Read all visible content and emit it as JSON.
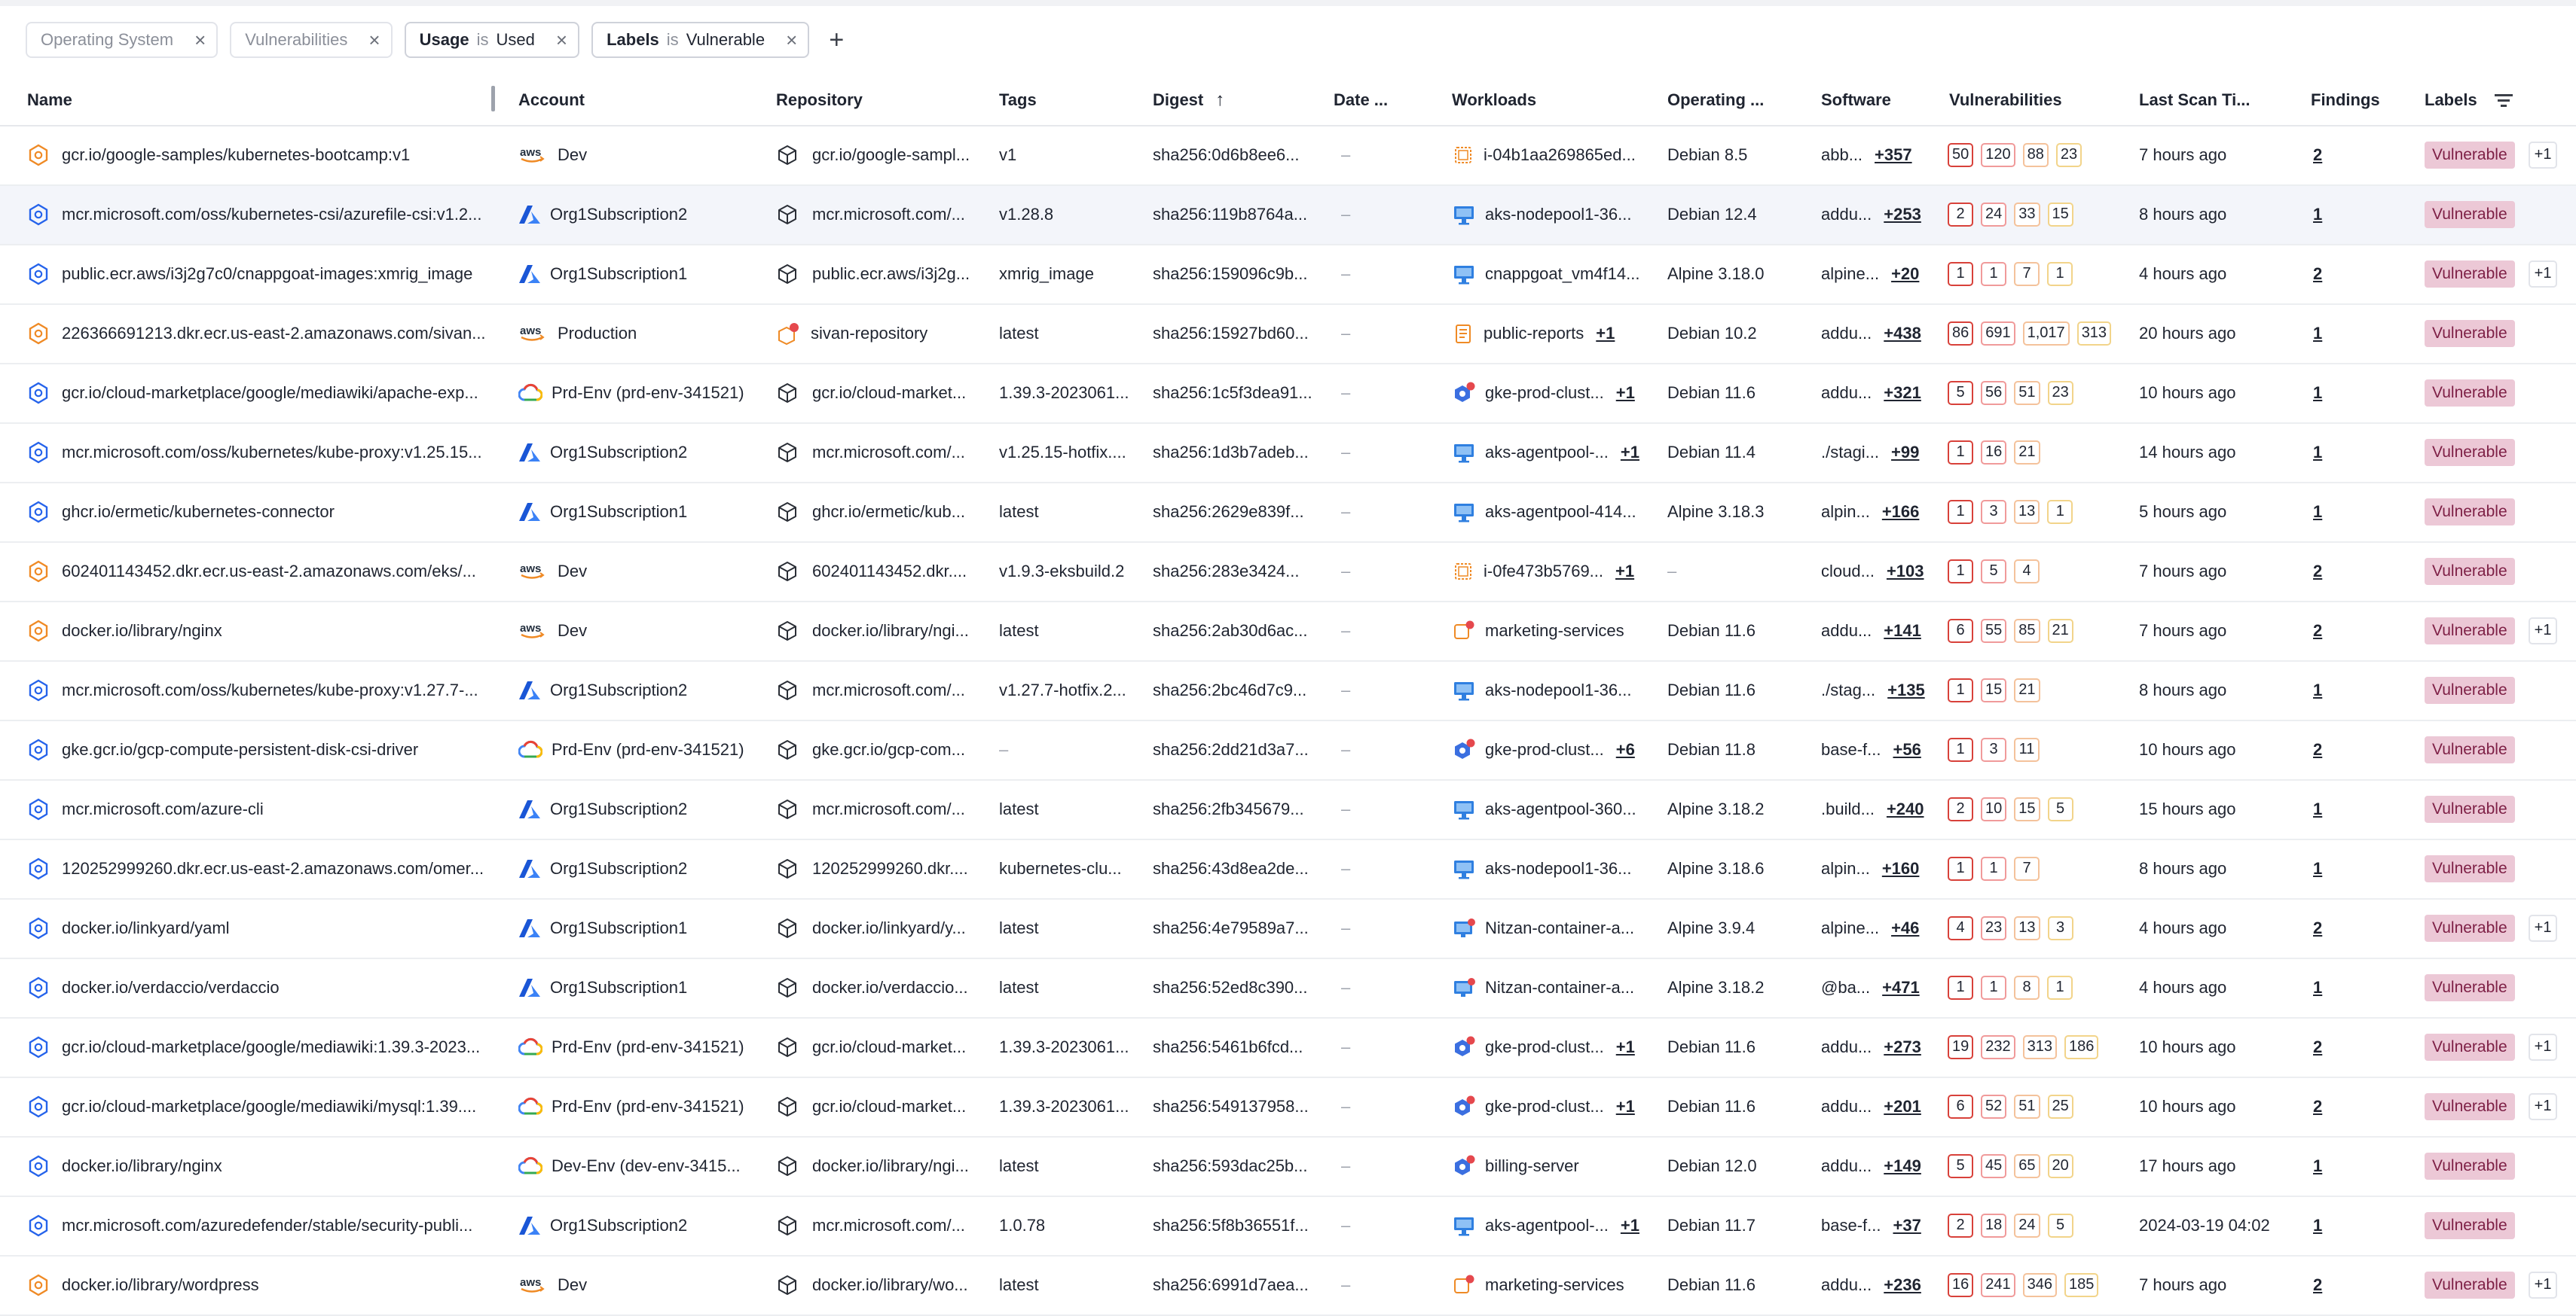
{
  "filters": [
    {
      "key": "Operating System",
      "active": false
    },
    {
      "key": "Vulnerabilities",
      "active": false
    },
    {
      "key": "Usage",
      "op": "is",
      "value": "Used",
      "active": true
    },
    {
      "key": "Labels",
      "op": "is",
      "value": "Vulnerable",
      "active": true
    }
  ],
  "filter_close_glyph": "×",
  "add_filter_glyph": "+",
  "columns": {
    "name": "Name",
    "account": "Account",
    "repository": "Repository",
    "tags": "Tags",
    "digest": "Digest",
    "date": "Date ...",
    "workloads": "Workloads",
    "os": "Operating ...",
    "software": "Software",
    "vulnerabilities": "Vulnerabilities",
    "last_scan": "Last Scan Ti...",
    "findings": "Findings",
    "labels": "Labels"
  },
  "colors": {
    "label_bg": "#ecc8d6",
    "label_fg": "#7d1f45",
    "critical": "#d8413a",
    "high": "#f09a9a",
    "medium": "#f4c29b",
    "low": "#f2d48a",
    "aws": "#ef8a25",
    "azure": "#2563eb"
  },
  "rows": [
    {
      "img": "hex-orange-icon",
      "name": "gcr.io/google-samples/kubernetes-bootcamp:v1",
      "acct_icon": "aws-logo-icon",
      "account": "Dev",
      "repository": "gcr.io/google-sampl...",
      "tag": "v1",
      "digest": "sha256:0d6b8ee6...",
      "date": "–",
      "wl_icon": "vm-instance-icon",
      "workload": "i-04b1aa269865ed...",
      "wl_more": "",
      "os": "Debian 8.5",
      "software": "abb...",
      "sw_more": "+357",
      "vulns": [
        "50",
        "120",
        "88",
        "23"
      ],
      "last_scan": "7 hours ago",
      "findings": "2",
      "label": "Vulnerable",
      "label_more": "+1"
    },
    {
      "img": "hex-blue-icon",
      "name": "mcr.microsoft.com/oss/kubernetes-csi/azurefile-csi:v1.2...",
      "acct_icon": "azure-logo-icon",
      "account": "Org1Subscription2",
      "repository": "mcr.microsoft.com/...",
      "tag": "v1.28.8",
      "digest": "sha256:119b8764a...",
      "date": "–",
      "wl_icon": "aks-node-icon",
      "workload": "aks-nodepool1-36...",
      "wl_more": "",
      "os": "Debian 12.4",
      "software": "addu...",
      "sw_more": "+253",
      "vulns": [
        "2",
        "24",
        "33",
        "15"
      ],
      "last_scan": "8 hours ago",
      "findings": "1",
      "label": "Vulnerable",
      "label_more": "",
      "hl": true
    },
    {
      "img": "hex-blue-icon",
      "name": "public.ecr.aws/i3j2g7c0/cnappgoat-images:xmrig_image",
      "acct_icon": "azure-logo-icon",
      "account": "Org1Subscription1",
      "repository": "public.ecr.aws/i3j2g...",
      "tag": "xmrig_image",
      "digest": "sha256:159096c9b...",
      "date": "–",
      "wl_icon": "aks-node-icon",
      "workload": "cnappgoat_vm4f14...",
      "wl_more": "",
      "os": "Alpine 3.18.0",
      "software": "alpine...",
      "sw_more": "+20",
      "vulns": [
        "1",
        "1",
        "7",
        "1"
      ],
      "last_scan": "4 hours ago",
      "findings": "2",
      "label": "Vulnerable",
      "label_more": "+1"
    },
    {
      "img": "hex-orange-icon",
      "name": "226366691213.dkr.ecr.us-east-2.amazonaws.com/sivan...",
      "acct_icon": "aws-logo-icon",
      "account": "Production",
      "repository": "sivan-repository",
      "repo_icon": "repo-warning-icon",
      "tag": "latest",
      "digest": "sha256:15927bd60...",
      "date": "–",
      "wl_icon": "task-doc-icon",
      "workload": "public-reports",
      "wl_more": "+1",
      "os": "Debian 10.2",
      "software": "addu...",
      "sw_more": "+438",
      "vulns": [
        "86",
        "691",
        "1,017",
        "313"
      ],
      "last_scan": "20 hours ago",
      "findings": "1",
      "label": "Vulnerable",
      "label_more": ""
    },
    {
      "img": "hex-blue-icon",
      "name": "gcr.io/cloud-marketplace/google/mediawiki/apache-exp...",
      "acct_icon": "gcp-logo-icon",
      "account": "Prd-Env (prd-env-341521)",
      "repository": "gcr.io/cloud-market...",
      "tag": "1.39.3-2023061...",
      "digest": "sha256:1c5f3dea91...",
      "date": "–",
      "wl_icon": "gke-cluster-icon",
      "workload": "gke-prod-clust...",
      "wl_more": "+1",
      "os": "Debian 11.6",
      "software": "addu...",
      "sw_more": "+321",
      "vulns": [
        "5",
        "56",
        "51",
        "23"
      ],
      "last_scan": "10 hours ago",
      "findings": "1",
      "label": "Vulnerable",
      "label_more": ""
    },
    {
      "img": "hex-blue-icon",
      "name": "mcr.microsoft.com/oss/kubernetes/kube-proxy:v1.25.15...",
      "acct_icon": "azure-logo-icon",
      "account": "Org1Subscription2",
      "repository": "mcr.microsoft.com/...",
      "tag": "v1.25.15-hotfix....",
      "digest": "sha256:1d3b7adeb...",
      "date": "–",
      "wl_icon": "aks-node-icon",
      "workload": "aks-agentpool-...",
      "wl_more": "+1",
      "os": "Debian 11.4",
      "software": "./stagi...",
      "sw_more": "+99",
      "vulns": [
        "1",
        "16",
        "21"
      ],
      "last_scan": "14 hours ago",
      "findings": "1",
      "label": "Vulnerable",
      "label_more": ""
    },
    {
      "img": "hex-blue-icon",
      "name": "ghcr.io/ermetic/kubernetes-connector",
      "acct_icon": "azure-logo-icon",
      "account": "Org1Subscription1",
      "repository": "ghcr.io/ermetic/kub...",
      "tag": "latest",
      "digest": "sha256:2629e839f...",
      "date": "–",
      "wl_icon": "aks-node-icon",
      "workload": "aks-agentpool-414...",
      "wl_more": "",
      "os": "Alpine 3.18.3",
      "software": "alpin...",
      "sw_more": "+166",
      "vulns": [
        "1",
        "3",
        "13",
        "1"
      ],
      "last_scan": "5 hours ago",
      "findings": "1",
      "label": "Vulnerable",
      "label_more": ""
    },
    {
      "img": "hex-orange-icon",
      "name": "602401143452.dkr.ecr.us-east-2.amazonaws.com/eks/...",
      "acct_icon": "aws-logo-icon",
      "account": "Dev",
      "repository": "602401143452.dkr....",
      "tag": "v1.9.3-eksbuild.2",
      "digest": "sha256:283e3424...",
      "date": "–",
      "wl_icon": "vm-instance-icon",
      "workload": "i-0fe473b5769...",
      "wl_more": "+1",
      "os": "–",
      "software": "cloud...",
      "sw_more": "+103",
      "vulns": [
        "1",
        "5",
        "4"
      ],
      "last_scan": "7 hours ago",
      "findings": "2",
      "label": "Vulnerable",
      "label_more": ""
    },
    {
      "img": "hex-orange-icon",
      "name": "docker.io/library/nginx",
      "acct_icon": "aws-logo-icon",
      "account": "Dev",
      "repository": "docker.io/library/ngi...",
      "tag": "latest",
      "digest": "sha256:2ab30d6ac...",
      "date": "–",
      "wl_icon": "ecs-service-icon",
      "workload": "marketing-services",
      "wl_more": "",
      "os": "Debian 11.6",
      "software": "addu...",
      "sw_more": "+141",
      "vulns": [
        "6",
        "55",
        "85",
        "21"
      ],
      "last_scan": "7 hours ago",
      "findings": "2",
      "label": "Vulnerable",
      "label_more": "+1"
    },
    {
      "img": "hex-blue-icon",
      "name": "mcr.microsoft.com/oss/kubernetes/kube-proxy:v1.27.7-...",
      "acct_icon": "azure-logo-icon",
      "account": "Org1Subscription2",
      "repository": "mcr.microsoft.com/...",
      "tag": "v1.27.7-hotfix.2...",
      "digest": "sha256:2bc46d7c9...",
      "date": "–",
      "wl_icon": "aks-node-icon",
      "workload": "aks-nodepool1-36...",
      "wl_more": "",
      "os": "Debian 11.6",
      "software": "./stag...",
      "sw_more": "+135",
      "vulns": [
        "1",
        "15",
        "21"
      ],
      "last_scan": "8 hours ago",
      "findings": "1",
      "label": "Vulnerable",
      "label_more": ""
    },
    {
      "img": "hex-blue-icon",
      "name": "gke.gcr.io/gcp-compute-persistent-disk-csi-driver",
      "acct_icon": "gcp-logo-icon",
      "account": "Prd-Env (prd-env-341521)",
      "repository": "gke.gcr.io/gcp-com...",
      "tag": "–",
      "digest": "sha256:2dd21d3a7...",
      "date": "–",
      "wl_icon": "gke-cluster-icon",
      "workload": "gke-prod-clust...",
      "wl_more": "+6",
      "os": "Debian 11.8",
      "software": "base-f...",
      "sw_more": "+56",
      "vulns": [
        "1",
        "3",
        "11"
      ],
      "last_scan": "10 hours ago",
      "findings": "2",
      "label": "Vulnerable",
      "label_more": ""
    },
    {
      "img": "hex-blue-icon",
      "name": "mcr.microsoft.com/azure-cli",
      "acct_icon": "azure-logo-icon",
      "account": "Org1Subscription2",
      "repository": "mcr.microsoft.com/...",
      "tag": "latest",
      "digest": "sha256:2fb345679...",
      "date": "–",
      "wl_icon": "aks-node-icon",
      "workload": "aks-agentpool-360...",
      "wl_more": "",
      "os": "Alpine 3.18.2",
      "software": ".build...",
      "sw_more": "+240",
      "vulns": [
        "2",
        "10",
        "15",
        "5"
      ],
      "last_scan": "15 hours ago",
      "findings": "1",
      "label": "Vulnerable",
      "label_more": ""
    },
    {
      "img": "hex-blue-icon",
      "name": "120252999260.dkr.ecr.us-east-2.amazonaws.com/omer...",
      "acct_icon": "azure-logo-icon",
      "account": "Org1Subscription2",
      "repository": "120252999260.dkr....",
      "tag": "kubernetes-clu...",
      "digest": "sha256:43d8ea2de...",
      "date": "–",
      "wl_icon": "aks-node-icon",
      "workload": "aks-nodepool1-36...",
      "wl_more": "",
      "os": "Alpine 3.18.6",
      "software": "alpin...",
      "sw_more": "+160",
      "vulns": [
        "1",
        "1",
        "7"
      ],
      "last_scan": "8 hours ago",
      "findings": "1",
      "label": "Vulnerable",
      "label_more": ""
    },
    {
      "img": "hex-blue-icon",
      "name": "docker.io/linkyard/yaml",
      "acct_icon": "azure-logo-icon",
      "account": "Org1Subscription1",
      "repository": "docker.io/linkyard/y...",
      "tag": "latest",
      "digest": "sha256:4e79589a7...",
      "date": "–",
      "wl_icon": "container-app-icon",
      "workload": "Nitzan-container-a...",
      "wl_more": "",
      "os": "Alpine 3.9.4",
      "software": "alpine...",
      "sw_more": "+46",
      "vulns": [
        "4",
        "23",
        "13",
        "3"
      ],
      "last_scan": "4 hours ago",
      "findings": "2",
      "label": "Vulnerable",
      "label_more": "+1"
    },
    {
      "img": "hex-blue-icon",
      "name": "docker.io/verdaccio/verdaccio",
      "acct_icon": "azure-logo-icon",
      "account": "Org1Subscription1",
      "repository": "docker.io/verdaccio...",
      "tag": "latest",
      "digest": "sha256:52ed8c390...",
      "date": "–",
      "wl_icon": "container-app-icon",
      "workload": "Nitzan-container-a...",
      "wl_more": "",
      "os": "Alpine 3.18.2",
      "software": "@ba...",
      "sw_more": "+471",
      "vulns": [
        "1",
        "1",
        "8",
        "1"
      ],
      "last_scan": "4 hours ago",
      "findings": "1",
      "label": "Vulnerable",
      "label_more": ""
    },
    {
      "img": "hex-blue-icon",
      "name": "gcr.io/cloud-marketplace/google/mediawiki:1.39.3-2023...",
      "acct_icon": "gcp-logo-icon",
      "account": "Prd-Env (prd-env-341521)",
      "repository": "gcr.io/cloud-market...",
      "tag": "1.39.3-2023061...",
      "digest": "sha256:5461b6fcd...",
      "date": "–",
      "wl_icon": "gke-cluster-icon",
      "workload": "gke-prod-clust...",
      "wl_more": "+1",
      "os": "Debian 11.6",
      "software": "addu...",
      "sw_more": "+273",
      "vulns": [
        "19",
        "232",
        "313",
        "186"
      ],
      "last_scan": "10 hours ago",
      "findings": "2",
      "label": "Vulnerable",
      "label_more": "+1"
    },
    {
      "img": "hex-blue-icon",
      "name": "gcr.io/cloud-marketplace/google/mediawiki/mysql:1.39....",
      "acct_icon": "gcp-logo-icon",
      "account": "Prd-Env (prd-env-341521)",
      "repository": "gcr.io/cloud-market...",
      "tag": "1.39.3-2023061...",
      "digest": "sha256:549137958...",
      "date": "–",
      "wl_icon": "gke-cluster-icon",
      "workload": "gke-prod-clust...",
      "wl_more": "+1",
      "os": "Debian 11.6",
      "software": "addu...",
      "sw_more": "+201",
      "vulns": [
        "6",
        "52",
        "51",
        "25"
      ],
      "last_scan": "10 hours ago",
      "findings": "2",
      "label": "Vulnerable",
      "label_more": "+1"
    },
    {
      "img": "hex-blue-icon",
      "name": "docker.io/library/nginx",
      "acct_icon": "gcp-logo-icon",
      "account": "Dev-Env (dev-env-3415...",
      "repository": "docker.io/library/ngi...",
      "tag": "latest",
      "digest": "sha256:593dac25b...",
      "date": "–",
      "wl_icon": "gke-cluster-icon",
      "workload": "billing-server",
      "wl_more": "",
      "os": "Debian 12.0",
      "software": "addu...",
      "sw_more": "+149",
      "vulns": [
        "5",
        "45",
        "65",
        "20"
      ],
      "last_scan": "17 hours ago",
      "findings": "1",
      "label": "Vulnerable",
      "label_more": ""
    },
    {
      "img": "hex-blue-icon",
      "name": "mcr.microsoft.com/azuredefender/stable/security-publi...",
      "acct_icon": "azure-logo-icon",
      "account": "Org1Subscription2",
      "repository": "mcr.microsoft.com/...",
      "tag": "1.0.78",
      "digest": "sha256:5f8b36551f...",
      "date": "–",
      "wl_icon": "aks-node-icon",
      "workload": "aks-agentpool-...",
      "wl_more": "+1",
      "os": "Debian 11.7",
      "software": "base-f...",
      "sw_more": "+37",
      "vulns": [
        "2",
        "18",
        "24",
        "5"
      ],
      "last_scan": "2024-03-19 04:02",
      "findings": "1",
      "label": "Vulnerable",
      "label_more": ""
    },
    {
      "img": "hex-orange-icon",
      "name": "docker.io/library/wordpress",
      "acct_icon": "aws-logo-icon",
      "account": "Dev",
      "repository": "docker.io/library/wo...",
      "tag": "latest",
      "digest": "sha256:6991d7aea...",
      "date": "–",
      "wl_icon": "ecs-service-icon",
      "workload": "marketing-services",
      "wl_more": "",
      "os": "Debian 11.6",
      "software": "addu...",
      "sw_more": "+236",
      "vulns": [
        "16",
        "241",
        "346",
        "185"
      ],
      "last_scan": "7 hours ago",
      "findings": "2",
      "label": "Vulnerable",
      "label_more": "+1"
    }
  ]
}
